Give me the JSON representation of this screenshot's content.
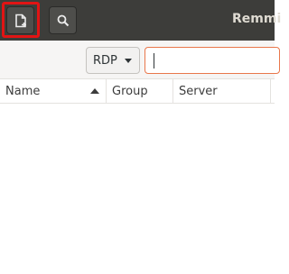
{
  "app": {
    "title": "Remmi"
  },
  "headerbar": {
    "new_connection_icon": "new-document-icon",
    "search_icon": "search-icon"
  },
  "toolbar": {
    "protocol": "RDP",
    "quick_connect_value": ""
  },
  "table": {
    "columns": [
      "Name",
      "Group",
      "Server"
    ],
    "rows": []
  },
  "colors": {
    "headerbar": "#3d3d3a",
    "annotation": "#e11414",
    "input_focus": "#e9774b"
  }
}
